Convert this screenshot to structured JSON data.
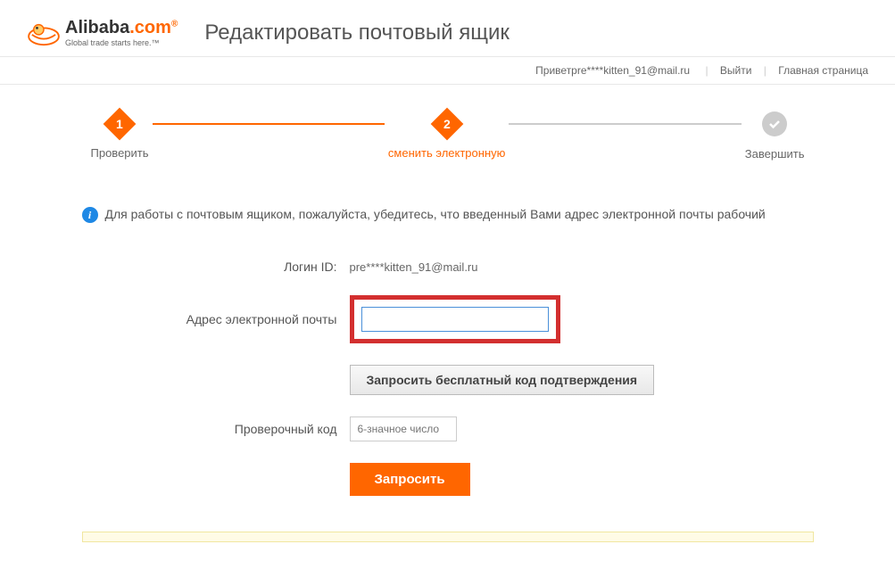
{
  "logo": {
    "brand_part1": "Alibaba",
    "brand_part2": ".com",
    "tagline": "Global trade starts here.™"
  },
  "page_title": "Редактировать почтовый ящик",
  "topbar": {
    "greeting": "Приветpre****kitten_91@mail.ru",
    "logout": "Выйти",
    "home": "Главная страница"
  },
  "steps": {
    "step1": {
      "num": "1",
      "label": "Проверить"
    },
    "step2": {
      "num": "2",
      "label": "сменить электронную"
    },
    "step3": {
      "label": "Завершить"
    }
  },
  "info_text": "Для работы с почтовым ящиком, пожалуйста, убедитесь, что введенный Вами адрес электронной почты рабочий",
  "form": {
    "login_id_label": "Логин ID:",
    "login_id_value": "pre****kitten_91@mail.ru",
    "email_label": "Адрес электронной почты",
    "request_code_btn": "Запросить бесплатный код подтверждения",
    "verify_label": "Проверочный код",
    "verify_placeholder": "6-значное число",
    "submit_btn": "Запросить"
  }
}
